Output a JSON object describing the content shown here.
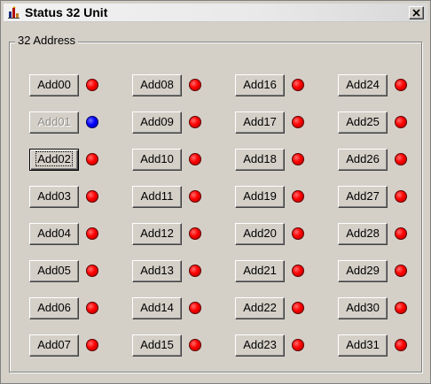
{
  "window": {
    "title": "Status 32 Unit",
    "close_symbol": "×"
  },
  "group": {
    "label": "32 Address"
  },
  "colors": {
    "status_red": "#ff0000",
    "status_blue": "#0000ff",
    "dialog_face": "#d4d0c8"
  },
  "icons": {
    "app": "app-icon",
    "close": "close-icon"
  },
  "addresses": [
    {
      "label": "Add00",
      "led": "red",
      "enabled": true,
      "focused": false
    },
    {
      "label": "Add01",
      "led": "blue",
      "enabled": false,
      "focused": false
    },
    {
      "label": "Add02",
      "led": "red",
      "enabled": true,
      "focused": true
    },
    {
      "label": "Add03",
      "led": "red",
      "enabled": true,
      "focused": false
    },
    {
      "label": "Add04",
      "led": "red",
      "enabled": true,
      "focused": false
    },
    {
      "label": "Add05",
      "led": "red",
      "enabled": true,
      "focused": false
    },
    {
      "label": "Add06",
      "led": "red",
      "enabled": true,
      "focused": false
    },
    {
      "label": "Add07",
      "led": "red",
      "enabled": true,
      "focused": false
    },
    {
      "label": "Add08",
      "led": "red",
      "enabled": true,
      "focused": false
    },
    {
      "label": "Add09",
      "led": "red",
      "enabled": true,
      "focused": false
    },
    {
      "label": "Add10",
      "led": "red",
      "enabled": true,
      "focused": false
    },
    {
      "label": "Add11",
      "led": "red",
      "enabled": true,
      "focused": false
    },
    {
      "label": "Add12",
      "led": "red",
      "enabled": true,
      "focused": false
    },
    {
      "label": "Add13",
      "led": "red",
      "enabled": true,
      "focused": false
    },
    {
      "label": "Add14",
      "led": "red",
      "enabled": true,
      "focused": false
    },
    {
      "label": "Add15",
      "led": "red",
      "enabled": true,
      "focused": false
    },
    {
      "label": "Add16",
      "led": "red",
      "enabled": true,
      "focused": false
    },
    {
      "label": "Add17",
      "led": "red",
      "enabled": true,
      "focused": false
    },
    {
      "label": "Add18",
      "led": "red",
      "enabled": true,
      "focused": false
    },
    {
      "label": "Add19",
      "led": "red",
      "enabled": true,
      "focused": false
    },
    {
      "label": "Add20",
      "led": "red",
      "enabled": true,
      "focused": false
    },
    {
      "label": "Add21",
      "led": "red",
      "enabled": true,
      "focused": false
    },
    {
      "label": "Add22",
      "led": "red",
      "enabled": true,
      "focused": false
    },
    {
      "label": "Add23",
      "led": "red",
      "enabled": true,
      "focused": false
    },
    {
      "label": "Add24",
      "led": "red",
      "enabled": true,
      "focused": false
    },
    {
      "label": "Add25",
      "led": "red",
      "enabled": true,
      "focused": false
    },
    {
      "label": "Add26",
      "led": "red",
      "enabled": true,
      "focused": false
    },
    {
      "label": "Add27",
      "led": "red",
      "enabled": true,
      "focused": false
    },
    {
      "label": "Add28",
      "led": "red",
      "enabled": true,
      "focused": false
    },
    {
      "label": "Add29",
      "led": "red",
      "enabled": true,
      "focused": false
    },
    {
      "label": "Add30",
      "led": "red",
      "enabled": true,
      "focused": false
    },
    {
      "label": "Add31",
      "led": "red",
      "enabled": true,
      "focused": false
    }
  ]
}
